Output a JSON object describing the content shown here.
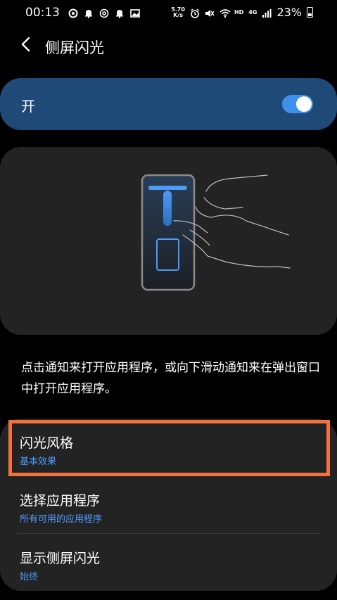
{
  "status_bar": {
    "time": "00:13",
    "net_speed_value": "5.70",
    "net_speed_unit": "K/s",
    "network_label": "HD",
    "network_gen": "4G",
    "battery": "23%"
  },
  "header": {
    "title": "侧屏闪光"
  },
  "master_toggle": {
    "label": "开",
    "state": "on",
    "accent_color": "#3e91ea"
  },
  "description": "点击通知来打开应用程序，或向下滑动通知来在弹出窗口中打开应用程序。",
  "settings": [
    {
      "title": "闪光风格",
      "subtitle": "基本效果"
    },
    {
      "title": "选择应用程序",
      "subtitle": "所有可用的应用程序"
    },
    {
      "title": "显示侧屏闪光",
      "subtitle": "始终"
    }
  ],
  "colors": {
    "background": "#000000",
    "toggle_card": "#1f4a78",
    "card": "#232323",
    "subtitle": "#4f9cff",
    "highlight": "#f4703d"
  }
}
